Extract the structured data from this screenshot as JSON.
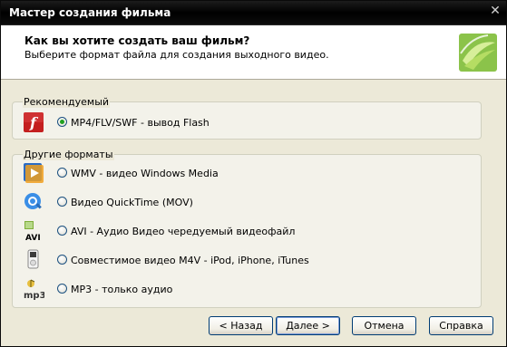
{
  "window": {
    "title": "Мастер создания фильма",
    "close_glyph": "✕"
  },
  "header": {
    "title": "Как вы хотите создать ваш фильм?",
    "subtitle": "Выберите формат файла для создания выходного видео."
  },
  "recommended": {
    "label": "Рекомендуемый",
    "options": [
      {
        "label": "MP4/FLV/SWF - вывод Flash",
        "icon": "flash-icon",
        "checked": true
      }
    ]
  },
  "other": {
    "label": "Другие форматы",
    "options": [
      {
        "label": "WMV - видео Windows Media",
        "icon": "windows-media-icon",
        "checked": false
      },
      {
        "label": "Видео QuickTime (MOV)",
        "icon": "quicktime-icon",
        "checked": false
      },
      {
        "label": "AVI - Аудио Видео чередуемый видеофайл",
        "icon": "avi-icon",
        "checked": false
      },
      {
        "label": "Совместимое видео M4V - iPod, iPhone, iTunes",
        "icon": "ipod-icon",
        "checked": false
      },
      {
        "label": "MP3 - только аудио",
        "icon": "mp3-icon",
        "checked": false
      }
    ]
  },
  "buttons": {
    "back": "< Назад",
    "next": "Далее >",
    "cancel": "Отмена",
    "help": "Справка"
  },
  "icon_text": {
    "flash": "f",
    "avi": "AVI",
    "mp3": "mp3"
  },
  "colors": {
    "accent_radio": "#21a121",
    "flash_red": "#c41f1f",
    "titlebar": "#000000"
  }
}
